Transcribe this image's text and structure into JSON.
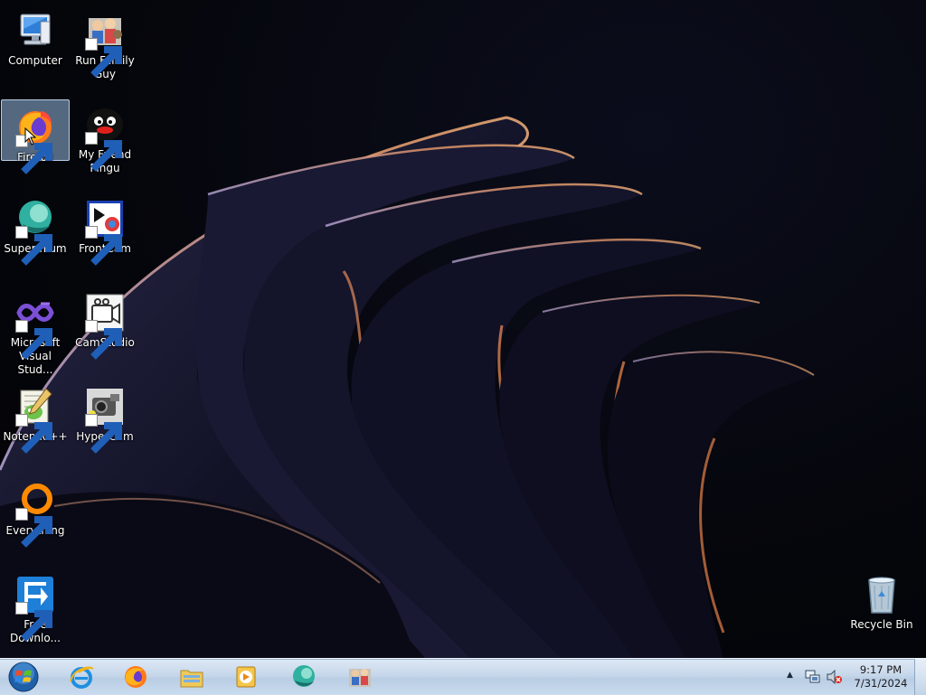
{
  "desktop": {
    "icons": [
      {
        "label": "Computer",
        "icon": "computer-icon"
      },
      {
        "label": "Run Family Guy",
        "icon": "family-guy-icon"
      },
      {
        "label": "Firefox",
        "icon": "firefox-icon",
        "selected": true
      },
      {
        "label": "My Friend Pingu",
        "icon": "pingu-icon"
      },
      {
        "label": "Supermium",
        "icon": "supermium-icon"
      },
      {
        "label": "FrontCam",
        "icon": "frontcam-icon"
      },
      {
        "label": "Microsoft Visual Stud...",
        "icon": "visual-studio-icon"
      },
      {
        "label": "CamStudio",
        "icon": "camstudio-icon"
      },
      {
        "label": "Notepad++",
        "icon": "notepad-plus-plus-icon"
      },
      {
        "label": "HyperCam",
        "icon": "hypercam-icon"
      },
      {
        "label": "Everything",
        "icon": "everything-icon"
      },
      {
        "label": "Free Downlo...",
        "icon": "free-download-manager-icon"
      },
      {
        "label": "Recycle Bin",
        "icon": "recycle-bin-icon"
      }
    ]
  },
  "taskbar": {
    "start": "windows-orb-icon",
    "pinned": [
      {
        "name": "Internet Explorer",
        "icon": "internet-explorer-icon"
      },
      {
        "name": "Firefox",
        "icon": "firefox-icon"
      },
      {
        "name": "Windows Explorer",
        "icon": "folder-icon"
      },
      {
        "name": "Windows Media Player",
        "icon": "media-player-icon"
      },
      {
        "name": "Supermium",
        "icon": "supermium-icon"
      },
      {
        "name": "Run Family Guy",
        "icon": "family-guy-icon"
      }
    ],
    "tray": {
      "show_hidden": "▲",
      "network_icon": "network-icon",
      "volume_icon": "volume-muted-icon",
      "time": "9:17 PM",
      "date": "7/31/2024"
    }
  },
  "colors": {
    "taskbar_top": "#dfe9f5",
    "taskbar_bottom": "#b9cde4",
    "selection": "#96b9e1",
    "wallpaper_glow": "#e0875a"
  }
}
